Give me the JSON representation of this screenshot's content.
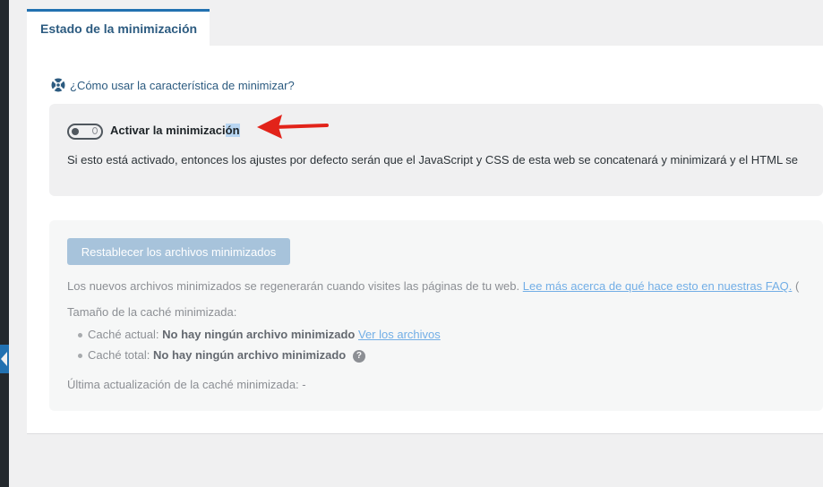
{
  "tab": {
    "label": "Estado de la minimización"
  },
  "help": {
    "label": "¿Cómo usar la característica de minimizar?"
  },
  "toggle": {
    "label_main": "Activar la minimizaci",
    "label_selected": "ón",
    "state": "off",
    "description": "Si esto está activado, entonces los ajustes por defecto serán que el JavaScript y CSS de esta web se concatenará y minimizará y el HTML se"
  },
  "cache": {
    "reset_button": "Restablecer los archivos minimizados",
    "regen_text": "Los nuevos archivos minimizados se regenerarán cuando visites las páginas de tu web.",
    "faq_link": "Lee más acerca de qué hace esto en nuestras FAQ.",
    "faq_trailing": "(",
    "size_heading": "Tamaño de la caché minimizada:",
    "current_label": "Caché actual:",
    "current_value": "No hay ningún archivo minimizado",
    "view_files": "Ver los archivos",
    "total_label": "Caché total:",
    "total_value": "No hay ningún archivo minimizado",
    "help_glyph": "?",
    "last_update": "Última actualización de la caché minimizada: -"
  },
  "colors": {
    "accent": "#2271b1",
    "arrow": "#e2231a"
  }
}
